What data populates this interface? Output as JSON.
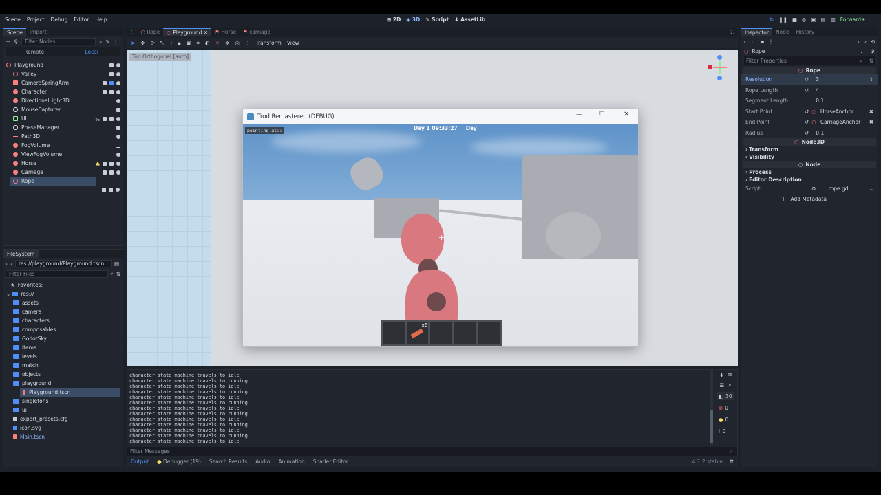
{
  "menu": [
    "Scene",
    "Project",
    "Debug",
    "Editor",
    "Help"
  ],
  "modes": {
    "m2d": "2D",
    "m3d": "3D",
    "script": "Script",
    "assetlib": "AssetLib"
  },
  "renderer": "Forward+",
  "scene_dock": {
    "tabs": [
      "Scene",
      "Import"
    ],
    "filter_placeholder": "Filter Nodes",
    "remote": "Remote",
    "local": "Local",
    "nodes": [
      "Playground",
      "Valley",
      "CameraSpringArm",
      "Character",
      "DirectionalLight3D",
      "MouseCapturer",
      "UI",
      "PhaseManager",
      "Path3D",
      "FogVolume",
      "ViewFogVolume",
      "Horse",
      "Carriage",
      "Rope"
    ]
  },
  "filesystem": {
    "title": "FileSystem",
    "path": "res://playground/Playground.tscn",
    "filter_placeholder": "Filter Files",
    "favorites": "Favorites:",
    "root": "res://",
    "items": [
      "assets",
      "camera",
      "characters",
      "composables",
      "GodotSky",
      "items",
      "levels",
      "match",
      "objects",
      "playground",
      "Playground.tscn",
      "singletons",
      "ui",
      "export_presets.cfg",
      "icon.svg",
      "Main.tscn"
    ]
  },
  "editor_tabs": [
    "Rope",
    "Playground",
    "Horse",
    "carriage"
  ],
  "viewport_menu": {
    "transform": "Transform",
    "view": "View",
    "ortho_label": "Top Orthogonal [auto]"
  },
  "game_window": {
    "title": "Trod Remastered (DEBUG)",
    "pointing": "pointing at::",
    "day_time": "Day 1 09:33:27",
    "day_label": "Day",
    "hotbar_count": "x6"
  },
  "console_lines": [
    "character state machine travels to idle",
    "character state machine travels to running",
    "character state machine travels to idle",
    "character state machine travels to running",
    "character state machine travels to idle",
    "character state machine travels to running",
    "character state machine travels to idle",
    "character state machine travels to running",
    "character state machine travels to idle",
    "character state machine travels to running",
    "character state machine travels to idle",
    "character state machine travels to running",
    "character state machine travels to idle"
  ],
  "console_filter_placeholder": "Filter Messages",
  "counters": {
    "messages": "30",
    "errors": "0",
    "warnings": "0",
    "info": "0"
  },
  "bottom_tabs": [
    "Output",
    "Debugger (19)",
    "Search Results",
    "Audio",
    "Animation",
    "Shader Editor"
  ],
  "version": "4.1.2.stable",
  "inspector": {
    "tabs": [
      "Inspector",
      "Node",
      "History"
    ],
    "node_name": "Rope",
    "filter_placeholder": "Filter Properties",
    "class_header": "Rope",
    "props": [
      {
        "k": "Resolution",
        "v": "3"
      },
      {
        "k": "Rope Length",
        "v": "4"
      },
      {
        "k": "Segment Length",
        "v": "0.1"
      },
      {
        "k": "Start Point",
        "v": "HorseAnchor"
      },
      {
        "k": "End Point",
        "v": "CarriageAnchor"
      },
      {
        "k": "Radius",
        "v": "0.1"
      }
    ],
    "node3d_header": "Node3D",
    "transform": "Transform",
    "visibility": "Visibility",
    "node_header": "Node",
    "process": "Process",
    "editor_description": "Editor Description",
    "script_label": "Script",
    "script_value": "rope.gd",
    "add_metadata": "Add Metadata"
  },
  "colors": {
    "accent": "#4f8ff7",
    "node3d": "#fc7f7f",
    "ui": "#8eef97",
    "warning": "#ffdd65"
  }
}
